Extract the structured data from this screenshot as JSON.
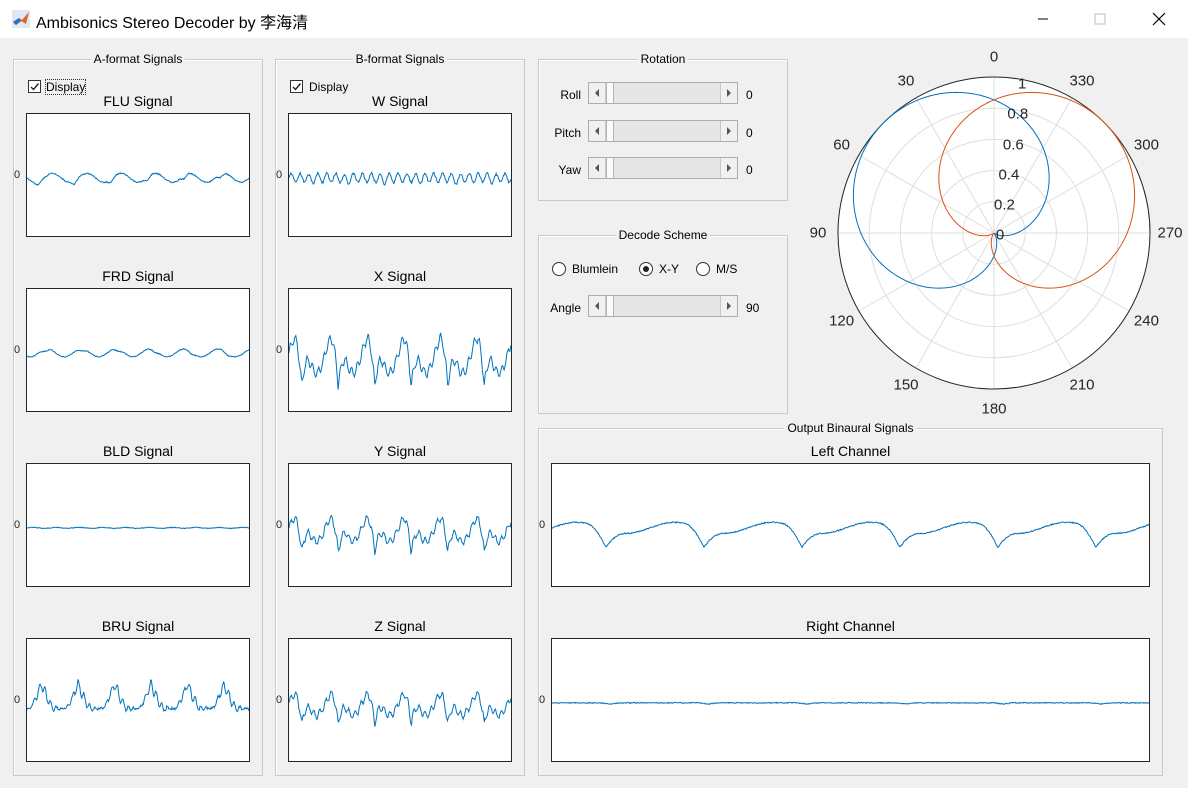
{
  "window": {
    "title": "Ambisonics Stereo Decoder by 李海清"
  },
  "a_format": {
    "panel_title": "A-format Signals",
    "display_label": "Display",
    "display_checked": true,
    "axes": [
      {
        "title": "FLU Signal",
        "ytick": "0"
      },
      {
        "title": "FRD Signal",
        "ytick": "0"
      },
      {
        "title": "BLD Signal",
        "ytick": "0"
      },
      {
        "title": "BRU Signal",
        "ytick": "0"
      }
    ]
  },
  "b_format": {
    "panel_title": "B-format Signals",
    "display_label": "Display",
    "display_checked": true,
    "axes": [
      {
        "title": "W Signal",
        "ytick": "0"
      },
      {
        "title": "X Signal",
        "ytick": "0"
      },
      {
        "title": "Y Signal",
        "ytick": "0"
      },
      {
        "title": "Z Signal",
        "ytick": "0"
      }
    ]
  },
  "rotation": {
    "panel_title": "Rotation",
    "sliders": [
      {
        "label": "Roll",
        "value": "0"
      },
      {
        "label": "Pitch",
        "value": "0"
      },
      {
        "label": "Yaw",
        "value": "0"
      }
    ]
  },
  "decode": {
    "panel_title": "Decode Scheme",
    "options": [
      "Blumlein",
      "X-Y",
      "M/S"
    ],
    "selected": "X-Y",
    "angle_label": "Angle",
    "angle_value": "90"
  },
  "polar": {
    "angle_labels": [
      "0",
      "30",
      "60",
      "90",
      "120",
      "150",
      "180",
      "210",
      "240",
      "270",
      "300",
      "330"
    ],
    "r_labels": [
      "0",
      "0.2",
      "0.4",
      "0.6",
      "0.8",
      "1"
    ],
    "rmax": 1,
    "series_colors": [
      "#0072bd",
      "#d95319"
    ],
    "pattern": "cardioid",
    "lobe_directions_deg": [
      45,
      315
    ]
  },
  "output": {
    "panel_title": "Output Binaural Signals",
    "axes": [
      {
        "title": "Left Channel",
        "ytick": "0"
      },
      {
        "title": "Right Channel",
        "ytick": "0"
      }
    ]
  },
  "colors": {
    "signal": "#0072bd",
    "series2": "#d95319",
    "background": "#f0f0f0"
  }
}
